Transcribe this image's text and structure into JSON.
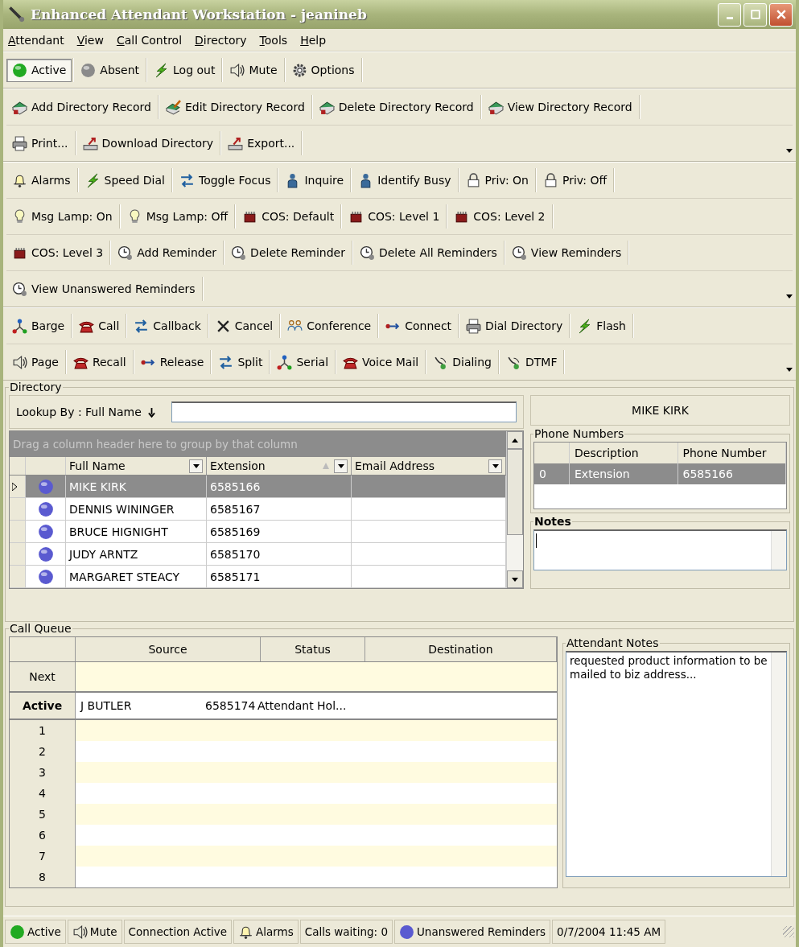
{
  "window": {
    "title": "Enhanced Attendant Workstation - jeanineb"
  },
  "menu": [
    "Attendant",
    "View",
    "Call Control",
    "Directory",
    "Tools",
    "Help"
  ],
  "toolbars": [
    {
      "rows": [
        {
          "buttons": [
            {
              "label": "Active",
              "pressed": true
            },
            {
              "label": "Absent",
              "pressed": false
            },
            {
              "label": "Log out",
              "pressed": false
            },
            {
              "label": "Mute",
              "pressed": false
            },
            {
              "label": "Options",
              "pressed": false
            }
          ]
        }
      ]
    },
    {
      "rows": [
        {
          "buttons": [
            {
              "label": "Add Directory Record"
            },
            {
              "label": "Edit Directory Record"
            },
            {
              "label": "Delete Directory Record"
            },
            {
              "label": "View Directory Record"
            }
          ]
        },
        {
          "buttons": [
            {
              "label": "Print..."
            },
            {
              "label": "Download Directory"
            },
            {
              "label": "Export..."
            }
          ]
        }
      ]
    },
    {
      "rows": [
        {
          "buttons": [
            {
              "label": "Alarms"
            },
            {
              "label": "Speed Dial"
            },
            {
              "label": "Toggle Focus"
            },
            {
              "label": "Inquire"
            },
            {
              "label": "Identify Busy"
            },
            {
              "label": "Priv: On"
            },
            {
              "label": "Priv: Off"
            }
          ]
        },
        {
          "buttons": [
            {
              "label": "Msg Lamp: On"
            },
            {
              "label": "Msg Lamp: Off"
            },
            {
              "label": "COS: Default"
            },
            {
              "label": "COS: Level 1"
            },
            {
              "label": "COS: Level 2"
            }
          ]
        },
        {
          "buttons": [
            {
              "label": "COS: Level 3"
            },
            {
              "label": "Add Reminder"
            },
            {
              "label": "Delete Reminder"
            },
            {
              "label": "Delete All Reminders"
            },
            {
              "label": "View Reminders"
            }
          ]
        },
        {
          "buttons": [
            {
              "label": "View Unanswered Reminders"
            }
          ]
        }
      ]
    },
    {
      "rows": [
        {
          "buttons": [
            {
              "label": "Barge"
            },
            {
              "label": "Call"
            },
            {
              "label": "Callback"
            },
            {
              "label": "Cancel"
            },
            {
              "label": "Conference"
            },
            {
              "label": "Connect"
            },
            {
              "label": "Dial Directory"
            },
            {
              "label": "Flash"
            }
          ]
        },
        {
          "buttons": [
            {
              "label": "Page"
            },
            {
              "label": "Recall"
            },
            {
              "label": "Release"
            },
            {
              "label": "Split"
            },
            {
              "label": "Serial"
            },
            {
              "label": "Voice Mail"
            },
            {
              "label": "Dialing"
            },
            {
              "label": "DTMF"
            }
          ]
        }
      ]
    }
  ],
  "directory": {
    "title": "Directory",
    "lookup_label": "Lookup By : Full Name",
    "group_hint": "Drag a column header here to group by that column",
    "columns": [
      "Full Name",
      "Extension",
      "Email Address"
    ],
    "rows": [
      {
        "name": "MIKE KIRK",
        "extension": "6585166",
        "selected": true
      },
      {
        "name": "DENNIS WININGER",
        "extension": "6585167",
        "selected": false
      },
      {
        "name": "BRUCE HIGNIGHT",
        "extension": "6585169",
        "selected": false
      },
      {
        "name": "JUDY ARNTZ",
        "extension": "6585170",
        "selected": false
      },
      {
        "name": "MARGARET STEACY",
        "extension": "6585171",
        "selected": false
      }
    ],
    "contact_name": "MIKE KIRK",
    "phone_numbers": {
      "title": "Phone Numbers",
      "columns": [
        "Description",
        "Phone Number"
      ],
      "rows": [
        {
          "index": "0",
          "description": "Extension",
          "number": "6585166",
          "selected": true
        }
      ]
    },
    "notes": {
      "title": "Notes"
    }
  },
  "call_queue": {
    "title": "Call Queue",
    "columns": [
      "Source",
      "Status",
      "Destination"
    ],
    "next_label": "Next",
    "active": {
      "label": "Active",
      "name": "J BUTLER",
      "number": "6585174",
      "status": "Attendant Hol..."
    },
    "slots": [
      "1",
      "2",
      "3",
      "4",
      "5",
      "6",
      "7",
      "8"
    ],
    "notes_title": "Attendant Notes",
    "notes_text": "requested product information to be mailed to biz address..."
  },
  "status_bar": [
    {
      "kind": "ball",
      "text": "Active",
      "color": "#22aa22"
    },
    {
      "kind": "speaker",
      "text": "Mute"
    },
    {
      "kind": "plain",
      "text": "Connection Active"
    },
    {
      "kind": "bell",
      "text": "Alarms"
    },
    {
      "kind": "plain",
      "text": "Calls waiting: 0"
    },
    {
      "kind": "ball",
      "text": "Unanswered Reminders",
      "color": "#5a5ad0"
    },
    {
      "kind": "plain",
      "text": "0/7/2004 11:45 AM"
    }
  ]
}
